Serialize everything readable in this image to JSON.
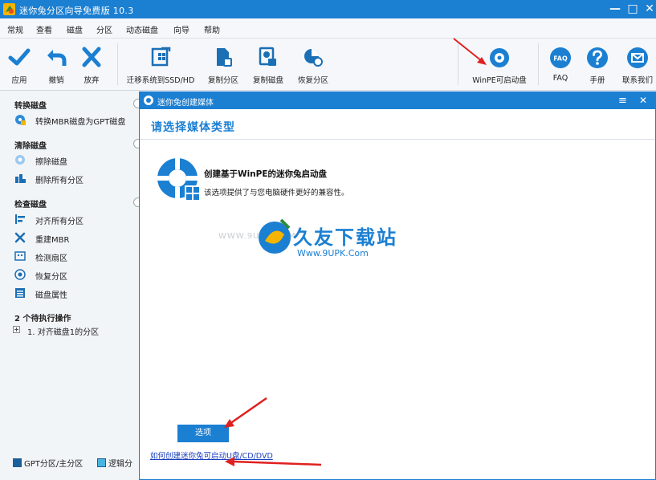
{
  "window": {
    "title": "迷你兔分区向导免费版 10.3",
    "controls": {
      "minimize": "—",
      "maximize": "□",
      "close": "✕"
    }
  },
  "menu": [
    "常规",
    "查看",
    "磁盘",
    "分区",
    "动态磁盘",
    "向导",
    "帮助"
  ],
  "toolbar": {
    "apply": "应用",
    "undo": "撤销",
    "discard": "放弃",
    "migrate": "迁移系统到SSD/HD",
    "copy_partition": "复制分区",
    "copy_disk": "复制磁盘",
    "recover_partition": "恢复分区",
    "winpe": "WinPE可启动盘",
    "faq": "FAQ",
    "faq_icon_text": "FAQ",
    "manual": "手册",
    "contact": "联系我们"
  },
  "sidebar": {
    "convert_header": "转换磁盘",
    "convert_items": [
      "转换MBR磁盘为GPT磁盘"
    ],
    "clean_header": "清除磁盘",
    "clean_items": [
      "擦除磁盘",
      "删除所有分区"
    ],
    "check_header": "检查磁盘",
    "check_items": [
      "对齐所有分区",
      "重建MBR",
      "检测扇区",
      "恢复分区",
      "磁盘属性"
    ],
    "pending_header": "2 个待执行操作",
    "pending_items": [
      "1. 对齐磁盘1的分区"
    ]
  },
  "legend": {
    "gpt_primary": "GPT分区/主分区",
    "logical": "逻辑分"
  },
  "dialog": {
    "title": "迷你兔创建媒体",
    "heading": "请选择媒体类型",
    "option_title": "创建基于WinPE的迷你兔启动盘",
    "option_desc": "该选项提供了与您电脑硬件更好的兼容性。",
    "options_button": "选项",
    "help_link": "如何创建迷你兔可启动U盘/CD/DVD",
    "menu_icon": "≡",
    "close_icon": "✕"
  },
  "watermark": {
    "left_text": "WWW.9UPK.COM",
    "brand_cn": "久友下载站",
    "url": "Www.9UPK.Com"
  },
  "colors": {
    "accent": "#1b7fd2",
    "annotation_arrow": "#e02020"
  }
}
